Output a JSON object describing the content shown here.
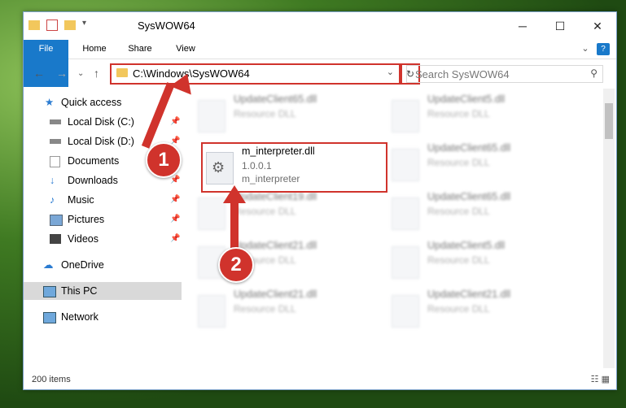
{
  "window": {
    "title": "SysWOW64",
    "minimize": "─",
    "maximize": "☐",
    "close": "✕",
    "help": "?",
    "collapse": "⌄"
  },
  "ribbon": {
    "tabs": [
      "File",
      "Home",
      "Share",
      "View"
    ]
  },
  "address": {
    "path": "C:\\Windows\\SysWOW64",
    "search_placeholder": "Search SysWOW64"
  },
  "nav": {
    "items": [
      {
        "label": "Quick access",
        "icon": "star-icon",
        "pinned": false
      },
      {
        "label": "Local Disk (C:)",
        "icon": "drive-icon",
        "pinned": true
      },
      {
        "label": "Local Disk (D:)",
        "icon": "drive-icon",
        "pinned": true
      },
      {
        "label": "Documents",
        "icon": "documents-icon",
        "pinned": true
      },
      {
        "label": "Downloads",
        "icon": "download-icon",
        "pinned": true
      },
      {
        "label": "Music",
        "icon": "music-icon",
        "pinned": true
      },
      {
        "label": "Pictures",
        "icon": "pictures-icon",
        "pinned": true
      },
      {
        "label": "Videos",
        "icon": "videos-icon",
        "pinned": true
      },
      {
        "label": "OneDrive",
        "icon": "cloud-icon",
        "pinned": false
      },
      {
        "label": "This PC",
        "icon": "pc-icon",
        "pinned": false
      },
      {
        "label": "Network",
        "icon": "network-icon",
        "pinned": false
      }
    ]
  },
  "files": {
    "highlighted": {
      "name": "m_interpreter.dll",
      "version": "1.0.0.1",
      "description": "m_interpreter"
    },
    "background": [
      {
        "name": "UpdateClient65.dll",
        "type": "Resource DLL"
      },
      {
        "name": "UpdateClient5.dll",
        "type": "Resource DLL"
      },
      {
        "name": "UpdateClient65.dll",
        "type": "Resource DLL"
      },
      {
        "name": "UpdateClient19.dll",
        "type": "Resource DLL"
      },
      {
        "name": "UpdateClient65.dll",
        "type": "Resource DLL"
      },
      {
        "name": "UpdateClient21.dll",
        "type": "Resource DLL"
      },
      {
        "name": "UpdateClient5.dll",
        "type": "Resource DLL"
      },
      {
        "name": "UpdateClient21.dll",
        "type": "Resource DLL"
      },
      {
        "name": "UpdateClient21.dll",
        "type": "Resource DLL"
      }
    ]
  },
  "status": {
    "items_count": "200 items"
  },
  "callouts": {
    "one": "1",
    "two": "2"
  },
  "colors": {
    "accent": "#1979ca",
    "callout": "#d0332c"
  }
}
